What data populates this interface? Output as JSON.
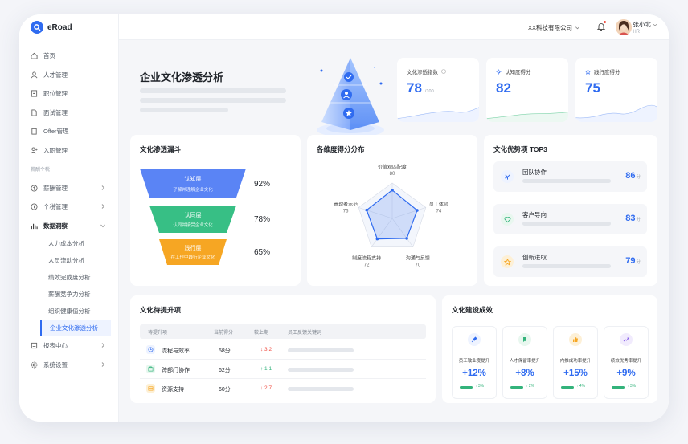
{
  "app": {
    "name": "eRoad"
  },
  "sidebar": {
    "items": [
      {
        "label": "首页",
        "icon": "home-icon"
      },
      {
        "label": "人才管理",
        "icon": "people-icon"
      },
      {
        "label": "职位管理",
        "icon": "building-icon"
      },
      {
        "label": "面试管理",
        "icon": "document-icon"
      },
      {
        "label": "Offer管理",
        "icon": "clipboard-icon"
      },
      {
        "label": "入职管理",
        "icon": "user-add-icon"
      }
    ],
    "group_label": "薪酬个税",
    "items2": [
      {
        "label": "薪酬管理",
        "icon": "money-icon"
      },
      {
        "label": "个税管理",
        "icon": "tax-icon"
      },
      {
        "label": "数据洞察",
        "icon": "chart-icon"
      }
    ],
    "sub_items": [
      "人力成本分析",
      "人员流动分析",
      "绩效完成度分析",
      "薪酬竞争力分析",
      "组织健康值分析",
      "企业文化渗透分析"
    ],
    "items3": [
      {
        "label": "报表中心",
        "icon": "report-icon"
      },
      {
        "label": "系统设置",
        "icon": "settings-icon"
      }
    ]
  },
  "topbar": {
    "company": "XX科技有限公司",
    "user_name": "张小北",
    "user_role": "HR"
  },
  "hero": {
    "title": "企业文化渗透分析"
  },
  "stats": [
    {
      "label": "文化渗透指数",
      "value": "78",
      "sub": "/100",
      "color": "#2f6bf0"
    },
    {
      "label": "认知度得分",
      "value": "82",
      "color": "#33b37b"
    },
    {
      "label": "践行度得分",
      "value": "75",
      "color": "#2f6bf0"
    }
  ],
  "funnel": {
    "title": "文化渗透漏斗",
    "stages": [
      {
        "name": "认知层",
        "desc": "了解并理解企业文化",
        "pct": "92%",
        "color": "#5a84f5"
      },
      {
        "name": "认同层",
        "desc": "认同并接受企业文化",
        "pct": "78%",
        "color": "#37bf85"
      },
      {
        "name": "践行层",
        "desc": "在工作中践行企业文化",
        "pct": "65%",
        "color": "#f6a623"
      }
    ]
  },
  "radar": {
    "title": "各维度得分分布",
    "dims": [
      {
        "name": "价值观匹配度",
        "value": 80
      },
      {
        "name": "员工体验",
        "value": 74
      },
      {
        "name": "沟通与反馈",
        "value": 70
      },
      {
        "name": "制度流程支持",
        "value": 72
      },
      {
        "name": "管理者示范",
        "value": 76
      }
    ]
  },
  "top3": {
    "title": "文化优势项 TOP3",
    "unit": "分",
    "items": [
      {
        "name": "团队协作",
        "score": "86",
        "icon": "collab-icon"
      },
      {
        "name": "客户导向",
        "score": "83",
        "icon": "heart-icon"
      },
      {
        "name": "创新进取",
        "score": "79",
        "icon": "star-icon"
      }
    ]
  },
  "improve": {
    "title": "文化待提升项",
    "headers": [
      "待提升项",
      "当前得分",
      "较上期",
      "员工反馈关键词"
    ],
    "rows": [
      {
        "name": "流程与效率",
        "score": "58分",
        "change": "↓ 3.2",
        "dir": "down",
        "icon": "clock-icon"
      },
      {
        "name": "跨部门协作",
        "score": "62分",
        "change": "↑ 1.1",
        "dir": "up",
        "icon": "team-icon"
      },
      {
        "name": "资源支持",
        "score": "60分",
        "change": "↓ 2.7",
        "dir": "down",
        "icon": "box-icon"
      }
    ]
  },
  "achieve": {
    "title": "文化建设成效",
    "items": [
      {
        "name": "员工敬业度提升",
        "value": "+12%",
        "trend": "↑ 3%",
        "color": "#2f6bf0",
        "icon": "pin-icon"
      },
      {
        "name": "人才保留率提升",
        "value": "+8%",
        "trend": "↑ 2%",
        "color": "#33b37b",
        "icon": "bookmark-icon"
      },
      {
        "name": "内推成功率提升",
        "value": "+15%",
        "trend": "↑ 4%",
        "color": "#f6a623",
        "icon": "thumb-icon"
      },
      {
        "name": "绩效优秀率提升",
        "value": "+9%",
        "trend": "↑ 3%",
        "color": "#8a63e8",
        "icon": "trend-icon"
      }
    ]
  }
}
